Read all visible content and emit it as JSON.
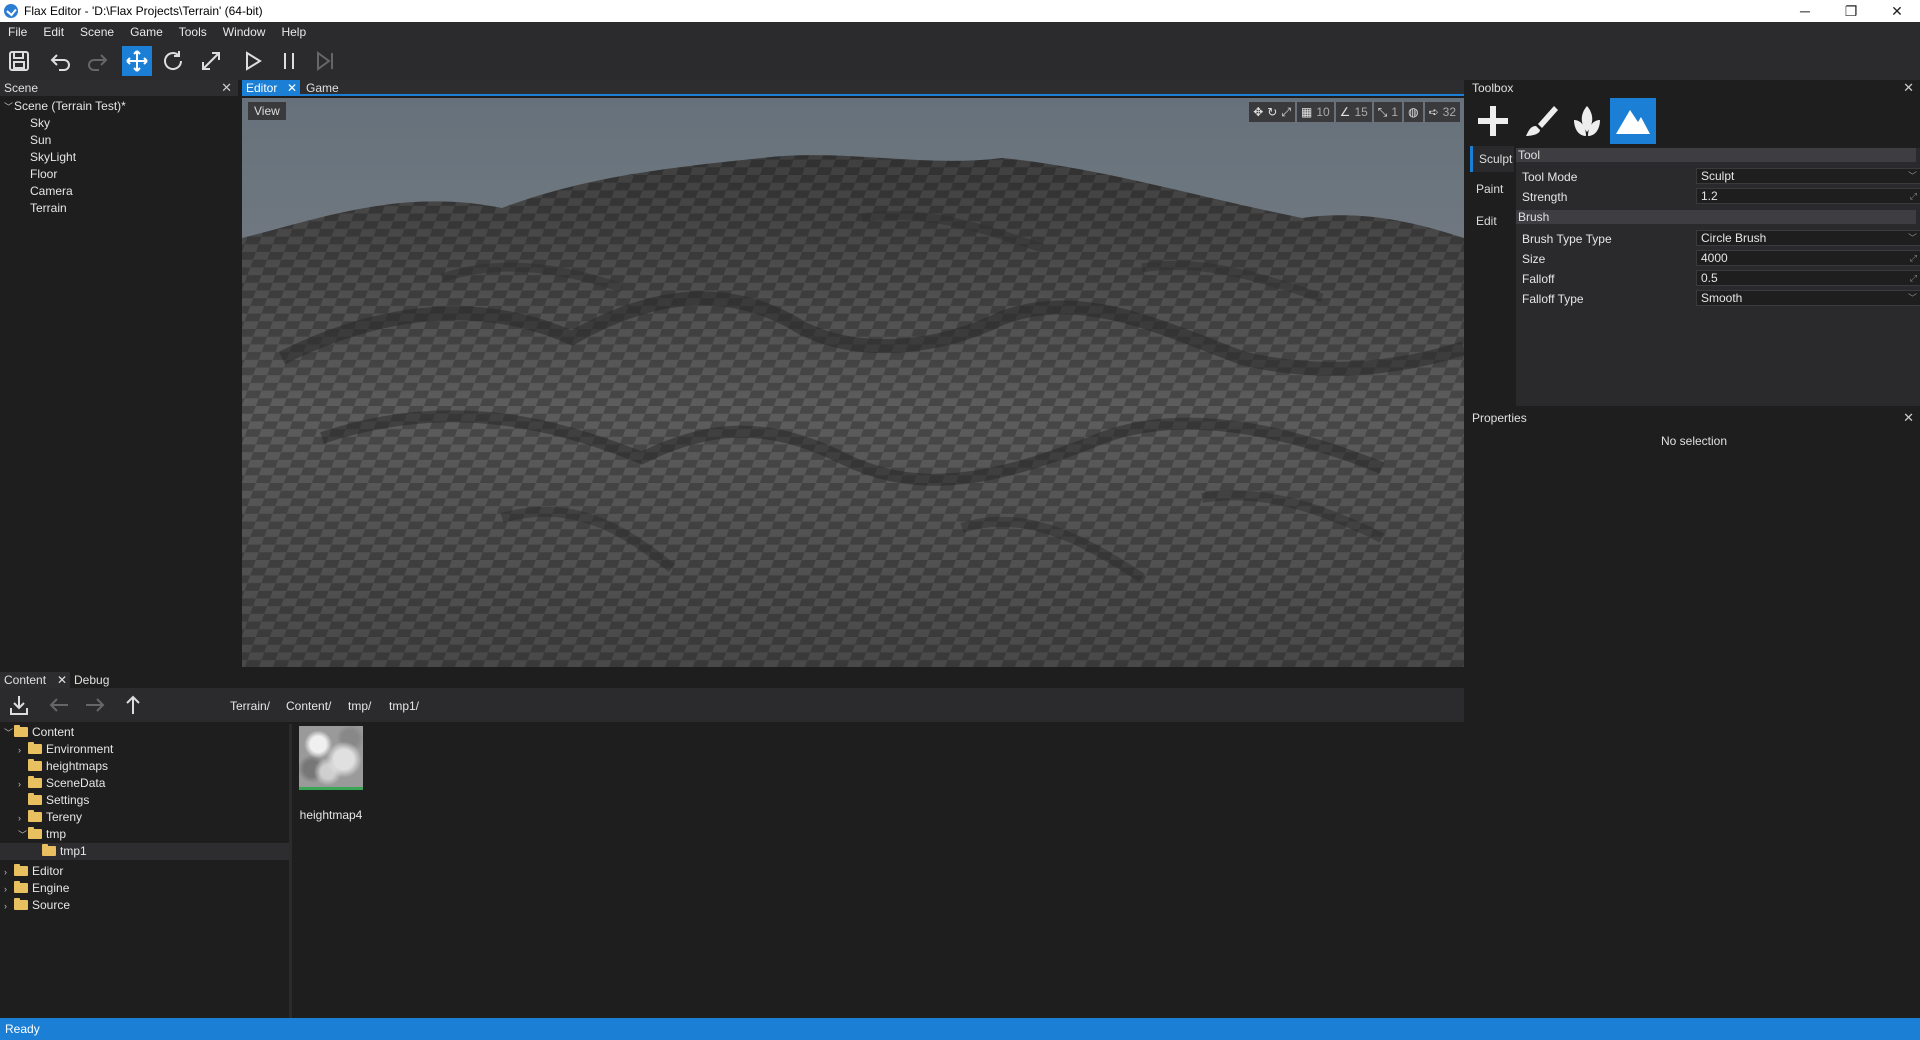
{
  "window": {
    "title": "Flax Editor - 'D:\\Flax Projects\\Terrain' (64-bit)",
    "minimize": "─",
    "maximize": "❐",
    "close": "✕"
  },
  "menu": [
    "File",
    "Edit",
    "Scene",
    "Game",
    "Tools",
    "Window",
    "Help"
  ],
  "toolbar": {
    "icons": [
      "save-icon",
      "undo-icon",
      "redo-icon",
      "translate-icon",
      "rotate-icon",
      "scale-icon",
      "play-icon",
      "pause-icon",
      "step-icon"
    ],
    "active": "translate-icon"
  },
  "scene": {
    "header": "Scene",
    "root": "Scene (Terrain Test)*",
    "items": [
      "Sky",
      "Sun",
      "SkyLight",
      "Floor",
      "Camera",
      "Terrain"
    ]
  },
  "viewport": {
    "tabs": [
      "Editor",
      "Game"
    ],
    "active_tab": "Editor",
    "view_button": "View",
    "grid_value": "10",
    "rotation_snap": "15",
    "scale_snap": "1",
    "camera_speed": "32"
  },
  "toolbox": {
    "header": "Toolbox",
    "mode_icons": [
      "add-icon",
      "paint-brush-icon",
      "foliage-icon",
      "terrain-icon"
    ],
    "active_mode": "terrain-icon",
    "side_tabs": [
      "Sculpt",
      "Paint",
      "Edit"
    ],
    "active_side_tab": "Sculpt",
    "tool_group": "Tool",
    "brush_group": "Brush",
    "tool_mode_label": "Tool Mode",
    "tool_mode_value": "Sculpt",
    "strength_label": "Strength",
    "strength_value": "1.2",
    "brush_type_label": "Brush Type Type",
    "brush_type_value": "Circle Brush",
    "size_label": "Size",
    "size_value": "4000",
    "falloff_label": "Falloff",
    "falloff_value": "0.5",
    "falloff_type_label": "Falloff Type",
    "falloff_type_value": "Smooth"
  },
  "properties": {
    "header": "Properties",
    "empty_text": "No selection"
  },
  "content": {
    "tabs": [
      "Content",
      "Debug"
    ],
    "breadcrumb": [
      "Terrain/",
      "Content/",
      "tmp/",
      "tmp1/"
    ],
    "tree": {
      "root": "Content",
      "children": [
        "Environment",
        "heightmaps",
        "SceneData",
        "Settings",
        "Tereny",
        "tmp"
      ],
      "tmp_child": "tmp1",
      "others": [
        "Editor",
        "Engine",
        "Source"
      ]
    },
    "assets": [
      {
        "name": "heightmap4"
      }
    ]
  },
  "status": {
    "text": "Ready"
  },
  "colors": {
    "accent": "#1c7fd6",
    "panel": "#1e1e1e",
    "header": "#2d2d30",
    "folder": "#e8c060"
  }
}
